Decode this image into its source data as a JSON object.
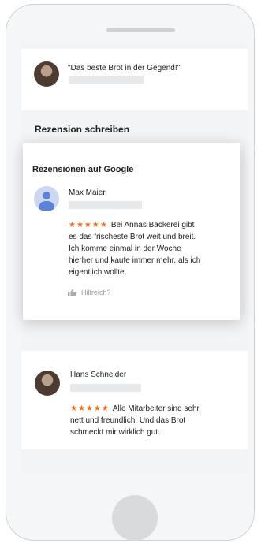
{
  "top_review": {
    "quote": "\"Das beste Brot in der Gegend!\""
  },
  "write_review": {
    "label": "Rezension schreiben"
  },
  "google_panel": {
    "heading": "Rezensionen auf Google",
    "review": {
      "author": "Max Maier",
      "stars": "★★★★★",
      "text_lines": [
        "Bei Annas Bäckerei gibt",
        "es das frischeste Brot weit und breit.",
        "Ich komme einmal in der Woche",
        "hierher und kaufe immer mehr, als ich",
        "eigentlich wollte."
      ],
      "helpful_label": "Hilfreich?"
    }
  },
  "second_review": {
    "author": "Hans Schneider",
    "stars": "★★★★★",
    "text_lines": [
      "Alle Mitarbeiter sind sehr",
      "nett und freundlich. Und das Brot",
      "schmeckt mir wirklich gut."
    ]
  },
  "icons": {
    "helpful": "thumbs-up-icon",
    "default_avatar": "person-icon"
  }
}
